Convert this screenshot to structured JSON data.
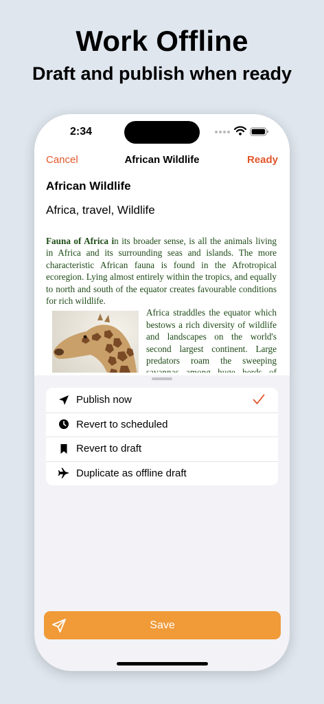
{
  "promo": {
    "headline": "Work Offline",
    "subheadline": "Draft and publish when ready"
  },
  "status_bar": {
    "time": "2:34"
  },
  "nav": {
    "cancel_label": "Cancel",
    "title": "African Wildlife",
    "ready_label": "Ready"
  },
  "post": {
    "title": "African Wildlife",
    "tags": "Africa, travel, Wildlife",
    "body_lead": "Fauna of Africa i",
    "body_p1": "n its broader sense, is all the animals living in Africa and its surrounding seas and islands. The more characteristic African fauna is found in the Afrotropical ecoregion. Lying almost entirely within the tropics, and equally to north and south of the equator creates favourable conditions for rich wildlife.",
    "body_p2": "Africa straddles the equator which bestows a rich diversity of wildlife and landscapes on the world's second largest continent. Large predators roam the sweeping savannas among huge herds of grazing animals.",
    "image": "giraffe-photo"
  },
  "menu": {
    "items": [
      {
        "label": "Publish now",
        "icon": "paper-plane-icon",
        "selected": true
      },
      {
        "label": "Revert to scheduled",
        "icon": "clock-icon",
        "selected": false
      },
      {
        "label": "Revert to draft",
        "icon": "bookmark-icon",
        "selected": false
      },
      {
        "label": "Duplicate as offline draft",
        "icon": "airplane-icon",
        "selected": false
      }
    ]
  },
  "save": {
    "label": "Save",
    "icon": "paper-plane-icon"
  },
  "colors": {
    "accent": "#e2562b",
    "save_button": "#f09a38",
    "background": "#dfe6ee",
    "article_text": "#1d4a16"
  }
}
